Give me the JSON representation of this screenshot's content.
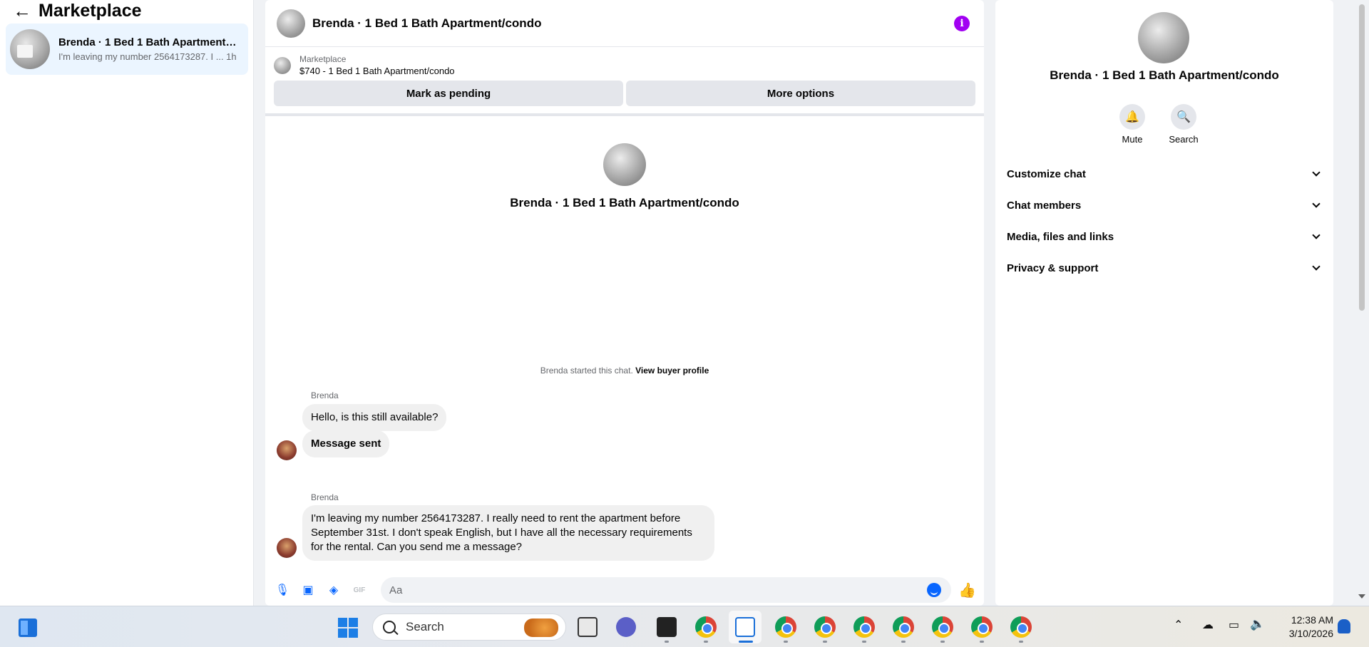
{
  "sidebar": {
    "title": "Marketplace",
    "conversation": {
      "name": "Brenda · 1 Bed 1 Bath Apartment/c...",
      "snippet": "I'm leaving my number 2564173287. I ... 1h"
    }
  },
  "chat": {
    "title": "Brenda · 1 Bed 1 Bath Apartment/condo",
    "listing_label": "Marketplace",
    "listing_price": "$740 - 1 Bed 1 Bath Apartment/condo",
    "mark_pending_label": "Mark as pending",
    "more_options_label": "More options",
    "intro_name": "Brenda · 1 Bed 1 Bath Apartment/condo",
    "started_text": "Brenda started this chat.",
    "view_buyer_profile": "View buyer profile",
    "messages": [
      {
        "sender": "Brenda",
        "text": "Hello, is this still available?"
      },
      {
        "text": "Message sent"
      },
      {
        "sender": "Brenda",
        "text": "I'm leaving my number 2564173287. I really need to rent the apartment before September 31st. I don't speak English, but I have all the necessary requirements for the rental. Can you send me a message?"
      }
    ],
    "composer_placeholder": "Aa",
    "composer_icons": [
      "microphone-icon",
      "photo-icon",
      "sticker-icon",
      "gif-icon",
      "emoji-icon",
      "like-icon"
    ]
  },
  "info_panel": {
    "name": "Brenda · 1 Bed 1 Bath Apartment/condo",
    "mute_label": "Mute",
    "search_label": "Search",
    "sections": [
      "Customize chat",
      "Chat members",
      "Media, files and links",
      "Privacy & support"
    ]
  },
  "taskbar": {
    "search_label": "Search",
    "time": "12:38 AM",
    "date": "3/10/2026"
  },
  "colors": {
    "accent": "#0866ff",
    "info": "#a100f2",
    "selected": "#ebf5ff"
  }
}
